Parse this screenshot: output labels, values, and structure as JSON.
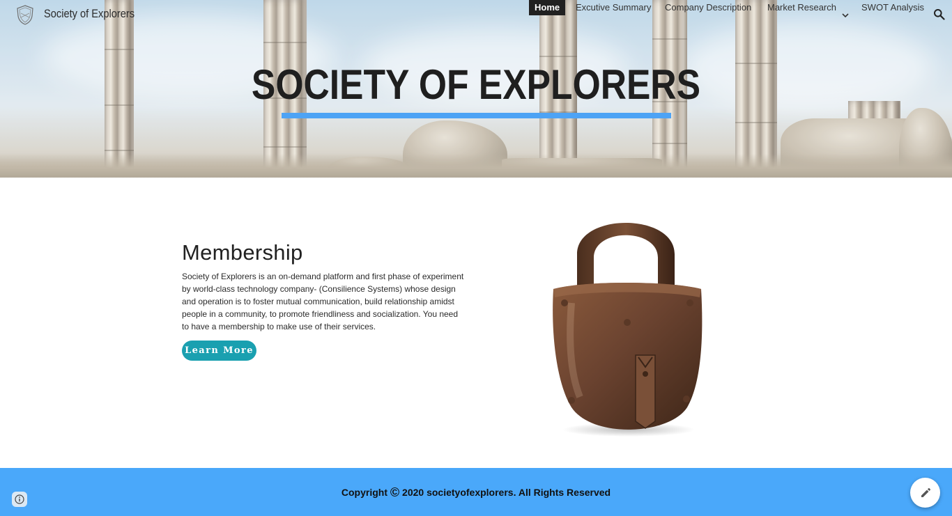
{
  "header": {
    "site_name": "Society of Explorers",
    "nav": [
      {
        "label": "Home",
        "active": true
      },
      {
        "label": "Excutive Summary"
      },
      {
        "label": "Company Description"
      },
      {
        "label": "Market Research",
        "has_dropdown": true
      },
      {
        "label": "SWOT Analysis"
      }
    ],
    "icons": {
      "logo": "shield-logo-icon",
      "search": "search-icon",
      "dropdown": "chevron-down-icon"
    }
  },
  "hero": {
    "title": "SOCIETY OF EXPLORERS",
    "underline_color": "#4da3f5"
  },
  "main": {
    "heading": "Membership",
    "body": "Society of Explorers is an on-demand platform and first phase of experiment by world-class technology company- (Consilience Systems) whose design and operation is to foster mutual communication, build relationship amidst people in a community, to promote friendliness and socialization. You need to have a membership to make use of their services.",
    "button_label": "Learn More",
    "button_color": "#1aa0b0",
    "image": "padlock-image"
  },
  "footer": {
    "copyright_prefix": "Copyright",
    "copyright_symbol": "©",
    "copyright_suffix": "2020 societyofexplorers. All Rights Reserved",
    "background_color": "#4aa8fa",
    "icons": {
      "info": "info-icon",
      "edit": "pencil-icon"
    }
  }
}
